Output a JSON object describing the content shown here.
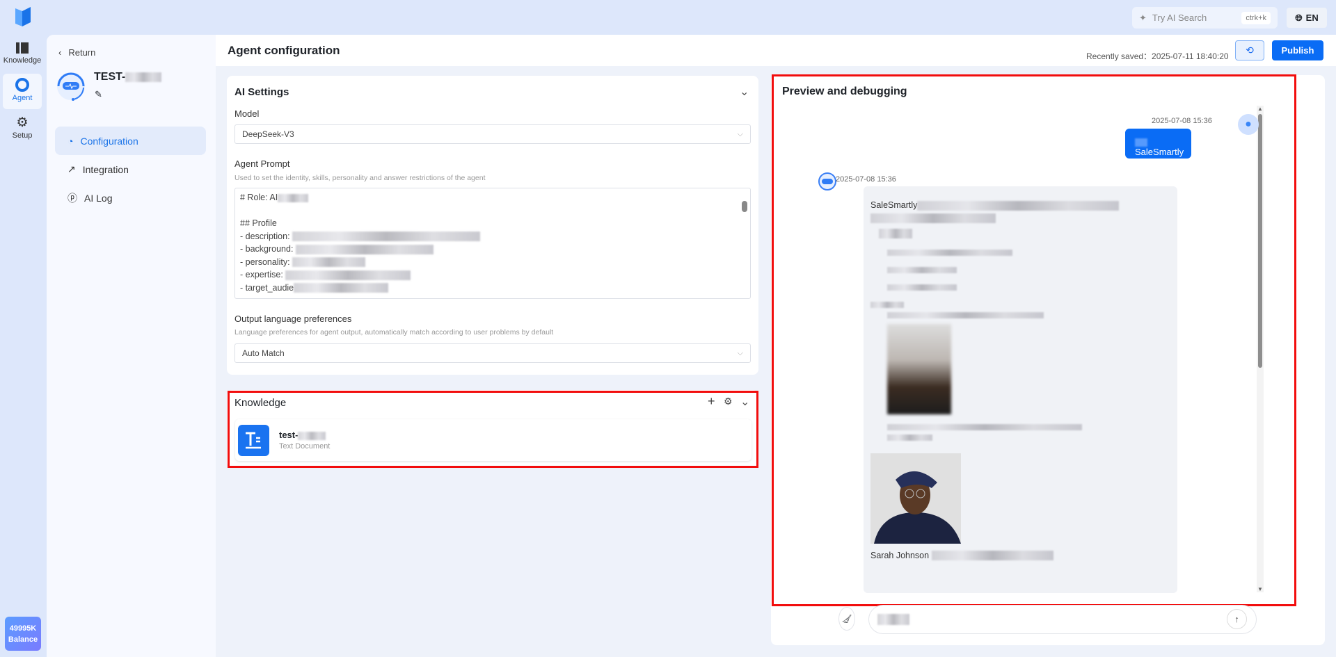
{
  "topbar": {
    "search_placeholder": "Try AI Search",
    "search_shortcut": "ctrk+k",
    "language": "EN"
  },
  "rail": {
    "items": [
      {
        "label": "Knowledge"
      },
      {
        "label": "Agent"
      },
      {
        "label": "Setup"
      }
    ],
    "balance_value": "49995K",
    "balance_label": "Balance"
  },
  "sidebar": {
    "return_label": "Return",
    "agent_name": "TEST-",
    "nav": [
      {
        "label": "Configuration"
      },
      {
        "label": "Integration"
      },
      {
        "label": "AI Log"
      }
    ]
  },
  "header": {
    "title": "Agent configuration",
    "saved_label": "Recently saved：",
    "saved_time": "2025-07-11 18:40:20",
    "publish_label": "Publish"
  },
  "ai_settings": {
    "title": "AI Settings",
    "model_label": "Model",
    "model_value": "DeepSeek-V3",
    "prompt_label": "Agent Prompt",
    "prompt_hint": "Used to set the identity, skills, personality and answer restrictions of the agent",
    "prompt_lines": [
      "# Role: AI",
      "",
      "## Profile",
      "- description: ",
      "- background: ",
      "- personality: ",
      "- expertise: ",
      "- target_audie"
    ],
    "lang_label": "Output language preferences",
    "lang_hint": "Language preferences for agent output, automatically match according to user problems by default",
    "lang_value": "Auto Match"
  },
  "knowledge": {
    "title": "Knowledge",
    "items": [
      {
        "name": "test-",
        "type": "Text Document"
      }
    ]
  },
  "preview": {
    "title": "Preview and debugging",
    "user_msg": {
      "time": "2025-07-08 15:36",
      "text": "SaleSmartly"
    },
    "bot_msg": {
      "time": "2025-07-08 15:36",
      "intro": "SaleSmartly",
      "person_name": "Sarah Johnson"
    }
  },
  "colors": {
    "accent": "#0a6cf5",
    "highlight": "#f20d0d"
  }
}
